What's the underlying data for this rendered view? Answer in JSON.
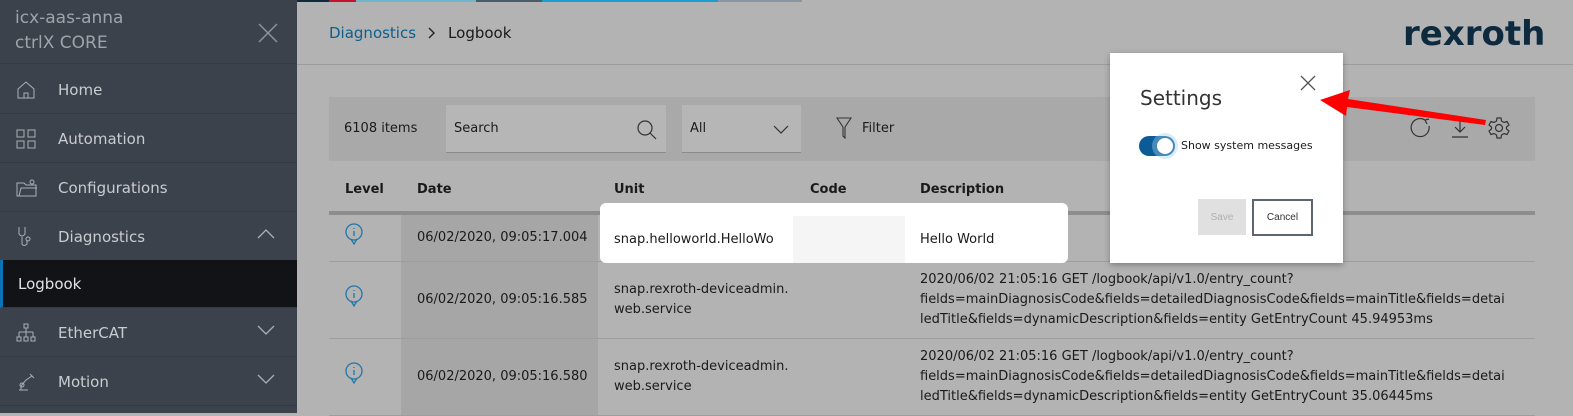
{
  "sidebar": {
    "device_name": "icx-aas-anna",
    "product": "ctrlX CORE",
    "items": [
      {
        "label": "Home",
        "icon": "home-icon"
      },
      {
        "label": "Automation",
        "icon": "grid-icon"
      },
      {
        "label": "Configurations",
        "icon": "folder-gear-icon"
      },
      {
        "label": "Diagnostics",
        "icon": "stethoscope-icon",
        "expanded": true
      },
      {
        "label": "Logbook",
        "active": true
      },
      {
        "label": "EtherCAT",
        "icon": "network-icon"
      },
      {
        "label": "Motion",
        "icon": "robot-arm-icon"
      }
    ]
  },
  "breadcrumb": {
    "parent": "Diagnostics",
    "current": "Logbook"
  },
  "logo": "rexroth",
  "toolbar": {
    "count": "6108 items",
    "search_placeholder": "Search",
    "select_value": "All",
    "filter_label": "Filter"
  },
  "table": {
    "headers": [
      "Level",
      "Date",
      "Unit",
      "Code",
      "Description"
    ],
    "rows": [
      {
        "level": "info",
        "date": "06/02/2020, 09:05:17.004",
        "unit": "snap.helloworld.HelloWo",
        "code": "",
        "description": "Hello World"
      },
      {
        "level": "info",
        "date": "06/02/2020, 09:05:16.585",
        "unit": "snap.rexroth-deviceadmin.web.service",
        "code": "",
        "description": "2020/06/02 21:05:16 GET /logbook/api/v1.0/entry_count?fields=mainDiagnosisCode&fields=detailedDiagnosisCode&fields=mainTitle&fields=detailedTitle&fields=dynamicDescription&fields=entity GetEntryCount 45.94953ms"
      },
      {
        "level": "info",
        "date": "06/02/2020, 09:05:16.580",
        "unit": "snap.rexroth-deviceadmin.web.service",
        "code": "",
        "description": "2020/06/02 21:05:16 GET /logbook/api/v1.0/entry_count?fields=mainDiagnosisCode&fields=detailedDiagnosisCode&fields=mainTitle&fields=detailedTitle&fields=dynamicDescription&fields=entity GetEntryCount 35.06445ms"
      }
    ]
  },
  "dialog": {
    "title": "Settings",
    "toggle_label": "Show system messages",
    "toggle_on": true,
    "save": "Save",
    "cancel": "Cancel"
  },
  "colors": {
    "accent": "#0b5b96",
    "sidebar": "#3b424b",
    "arrow": "#ff0000"
  }
}
